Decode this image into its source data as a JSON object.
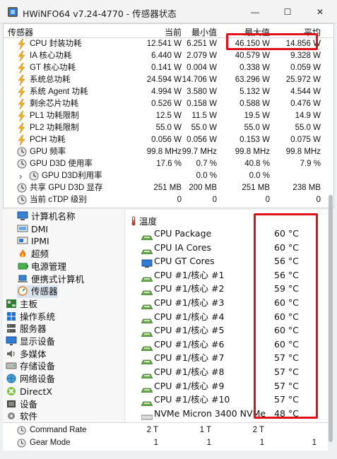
{
  "window": {
    "title": "HWiNFO64 v7.24-4770 - 传感器状态",
    "minimize_glyph": "—",
    "maximize_glyph": "☐",
    "close_glyph": "✕"
  },
  "columns": {
    "sensor": "传感器",
    "current": "当前",
    "min": "最小值",
    "max": "最大值",
    "avg": "平均"
  },
  "sensor_rows": [
    {
      "name": "CPU 封装功耗",
      "icon": "bolt-icon",
      "current": "12.541 W",
      "min": "6.251 W",
      "max": "46.150 W",
      "avg": "14.856 W"
    },
    {
      "name": "IA 核心功耗",
      "icon": "bolt-icon",
      "current": "6.440 W",
      "min": "2.079 W",
      "max": "40.579 W",
      "avg": "9.328 W"
    },
    {
      "name": "GT 核心功耗",
      "icon": "bolt-icon",
      "current": "0.141 W",
      "min": "0.004 W",
      "max": "0.338 W",
      "avg": "0.059 W"
    },
    {
      "name": "系统总功耗",
      "icon": "bolt-icon",
      "current": "24.594 W",
      "min": "14.706 W",
      "max": "63.296 W",
      "avg": "25.972 W"
    },
    {
      "name": "系统 Agent 功耗",
      "icon": "bolt-icon",
      "current": "4.994 W",
      "min": "3.580 W",
      "max": "5.132 W",
      "avg": "4.544 W"
    },
    {
      "name": "剩余芯片功耗",
      "icon": "bolt-icon",
      "current": "0.526 W",
      "min": "0.158 W",
      "max": "0.588 W",
      "avg": "0.476 W"
    },
    {
      "name": "PL1 功耗限制",
      "icon": "bolt-icon",
      "current": "12.5 W",
      "min": "11.5 W",
      "max": "19.5 W",
      "avg": "14.9 W"
    },
    {
      "name": "PL2 功耗限制",
      "icon": "bolt-icon",
      "current": "55.0 W",
      "min": "55.0 W",
      "max": "55.0 W",
      "avg": "55.0 W"
    },
    {
      "name": "PCH 功耗",
      "icon": "bolt-icon",
      "current": "0.056 W",
      "min": "0.056 W",
      "max": "0.153 W",
      "avg": "0.075 W"
    },
    {
      "name": "GPU 频率",
      "icon": "clock-icon",
      "current": "99.8 MHz",
      "min": "99.7 MHz",
      "max": "99.8 MHz",
      "avg": "99.8 MHz"
    },
    {
      "name": "GPU D3D 使用率",
      "icon": "clock-icon",
      "current": "17.6 %",
      "min": "0.7 %",
      "max": "40.8 %",
      "avg": "7.9 %"
    },
    {
      "name": "GPU D3D利用率",
      "icon": "clock-icon",
      "current": "",
      "min": "0.0 %",
      "max": "0.0 %",
      "avg": "",
      "expander": "›"
    },
    {
      "name": "共享 GPU D3D 显存",
      "icon": "clock-icon",
      "current": "251 MB",
      "min": "200 MB",
      "max": "251 MB",
      "avg": "238 MB"
    },
    {
      "name": "当前 cTDP 级别",
      "icon": "clock-icon",
      "current": "0",
      "min": "0",
      "max": "0",
      "avg": "0"
    }
  ],
  "tree": [
    {
      "label": "计算机名称",
      "icon": "computer-icon"
    },
    {
      "label": "DMI",
      "icon": "dmi-icon"
    },
    {
      "label": "IPMI",
      "icon": "ipmi-icon"
    },
    {
      "label": "超频",
      "icon": "flame-icon"
    },
    {
      "label": "电源管理",
      "icon": "power-icon"
    },
    {
      "label": "便携式计算机",
      "icon": "laptop-icon"
    },
    {
      "label": "传感器",
      "icon": "gauge-icon"
    },
    {
      "label": "主板",
      "icon": "motherboard-icon"
    },
    {
      "label": "操作系统",
      "icon": "windows-icon"
    },
    {
      "label": "服务器",
      "icon": "server-icon"
    },
    {
      "label": "显示设备",
      "icon": "display-icon"
    },
    {
      "label": "多媒体",
      "icon": "speaker-icon"
    },
    {
      "label": "存储设备",
      "icon": "disk-icon"
    },
    {
      "label": "网络设备",
      "icon": "network-icon"
    },
    {
      "label": "DirectX",
      "icon": "directx-icon"
    },
    {
      "label": "设备",
      "icon": "device-icon"
    },
    {
      "label": "软件",
      "icon": "software-icon"
    }
  ],
  "detail": {
    "section_title": "温度",
    "section_icon": "thermometer-icon",
    "rows": [
      {
        "name": "CPU Package",
        "value": "60 °C",
        "icon": "chip-icon"
      },
      {
        "name": "CPU IA Cores",
        "value": "60 °C",
        "icon": "chip-icon"
      },
      {
        "name": "CPU GT Cores",
        "value": "56 °C",
        "icon": "gpu-icon"
      },
      {
        "name": "CPU #1/核心 #1",
        "value": "56 °C",
        "icon": "chip-icon"
      },
      {
        "name": "CPU #1/核心 #2",
        "value": "59 °C",
        "icon": "chip-icon"
      },
      {
        "name": "CPU #1/核心 #3",
        "value": "60 °C",
        "icon": "chip-icon"
      },
      {
        "name": "CPU #1/核心 #4",
        "value": "60 °C",
        "icon": "chip-icon"
      },
      {
        "name": "CPU #1/核心 #5",
        "value": "60 °C",
        "icon": "chip-icon"
      },
      {
        "name": "CPU #1/核心 #6",
        "value": "60 °C",
        "icon": "chip-icon"
      },
      {
        "name": "CPU #1/核心 #7",
        "value": "57 °C",
        "icon": "chip-icon"
      },
      {
        "name": "CPU #1/核心 #8",
        "value": "57 °C",
        "icon": "chip-icon"
      },
      {
        "name": "CPU #1/核心 #9",
        "value": "57 °C",
        "icon": "chip-icon"
      },
      {
        "name": "CPU #1/核心 #10",
        "value": "57 °C",
        "icon": "chip-icon"
      },
      {
        "name": "NVMe Micron 3400 NVMe",
        "value": "48 °C",
        "icon": "ssd-icon"
      }
    ]
  },
  "bottom_rows": [
    {
      "name": "Command Rate",
      "current": "2 T",
      "min": "1 T",
      "max": "2 T",
      "avg": ""
    },
    {
      "name": "Gear Mode",
      "current": "1",
      "min": "1",
      "max": "1",
      "avg": "1"
    }
  ],
  "colors": {
    "highlight": "#e0101a",
    "bolt": "#f2b01e",
    "chip": "#4f8f3a",
    "selection": "#d9e3ef"
  }
}
